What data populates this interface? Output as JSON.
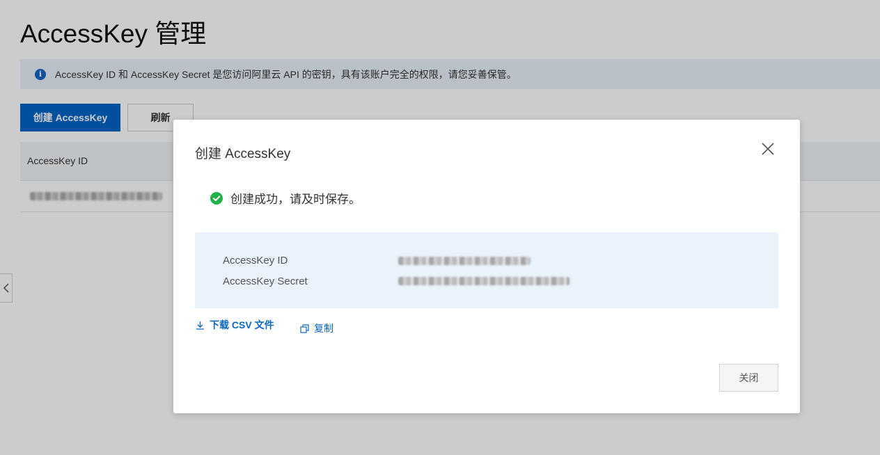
{
  "page": {
    "title": "AccessKey 管理",
    "notice": "AccessKey ID 和 AccessKey Secret 是您访问阿里云 API 的密钥，具有该账户完全的权限，请您妥善保管。",
    "create_button": "创建 AccessKey",
    "refresh_button": "刷新",
    "table": {
      "columns": [
        "AccessKey ID"
      ]
    }
  },
  "dialog": {
    "title": "创建 AccessKey",
    "success_message": "创建成功，请及时保存。",
    "fields": [
      {
        "label": "AccessKey ID"
      },
      {
        "label": "AccessKey Secret"
      }
    ],
    "download_link": "下载 CSV 文件",
    "copy_link": "复制",
    "close_button": "关闭"
  },
  "colors": {
    "primary": "#0064c8",
    "success": "#22b24c",
    "notice_bg": "#e9f1fb",
    "key_box_bg": "#eaf2fb"
  }
}
